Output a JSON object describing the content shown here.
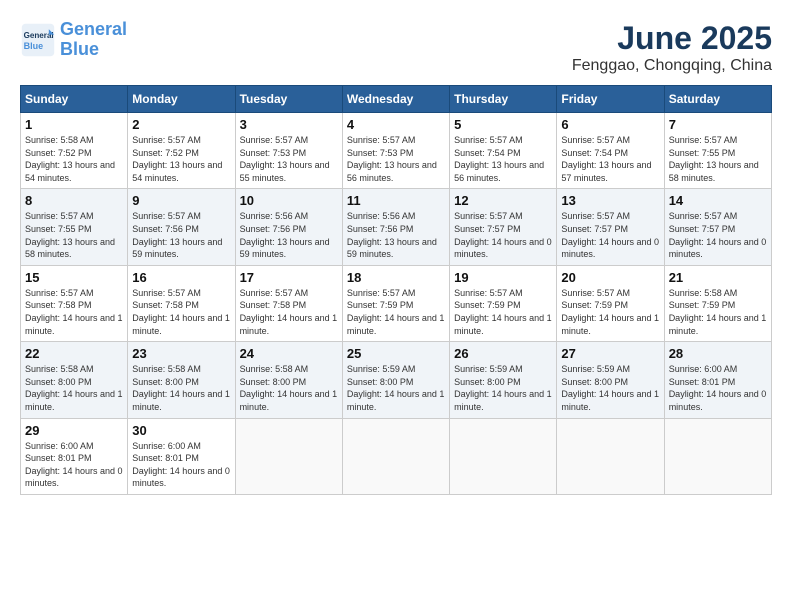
{
  "header": {
    "logo_line1": "General",
    "logo_line2": "Blue",
    "month": "June 2025",
    "location": "Fenggao, Chongqing, China"
  },
  "days_of_week": [
    "Sunday",
    "Monday",
    "Tuesday",
    "Wednesday",
    "Thursday",
    "Friday",
    "Saturday"
  ],
  "weeks": [
    [
      {
        "day": "1",
        "sunrise": "5:58 AM",
        "sunset": "7:52 PM",
        "daylight": "13 hours and 54 minutes."
      },
      {
        "day": "2",
        "sunrise": "5:57 AM",
        "sunset": "7:52 PM",
        "daylight": "13 hours and 54 minutes."
      },
      {
        "day": "3",
        "sunrise": "5:57 AM",
        "sunset": "7:53 PM",
        "daylight": "13 hours and 55 minutes."
      },
      {
        "day": "4",
        "sunrise": "5:57 AM",
        "sunset": "7:53 PM",
        "daylight": "13 hours and 56 minutes."
      },
      {
        "day": "5",
        "sunrise": "5:57 AM",
        "sunset": "7:54 PM",
        "daylight": "13 hours and 56 minutes."
      },
      {
        "day": "6",
        "sunrise": "5:57 AM",
        "sunset": "7:54 PM",
        "daylight": "13 hours and 57 minutes."
      },
      {
        "day": "7",
        "sunrise": "5:57 AM",
        "sunset": "7:55 PM",
        "daylight": "13 hours and 58 minutes."
      }
    ],
    [
      {
        "day": "8",
        "sunrise": "5:57 AM",
        "sunset": "7:55 PM",
        "daylight": "13 hours and 58 minutes."
      },
      {
        "day": "9",
        "sunrise": "5:57 AM",
        "sunset": "7:56 PM",
        "daylight": "13 hours and 59 minutes."
      },
      {
        "day": "10",
        "sunrise": "5:56 AM",
        "sunset": "7:56 PM",
        "daylight": "13 hours and 59 minutes."
      },
      {
        "day": "11",
        "sunrise": "5:56 AM",
        "sunset": "7:56 PM",
        "daylight": "13 hours and 59 minutes."
      },
      {
        "day": "12",
        "sunrise": "5:57 AM",
        "sunset": "7:57 PM",
        "daylight": "14 hours and 0 minutes."
      },
      {
        "day": "13",
        "sunrise": "5:57 AM",
        "sunset": "7:57 PM",
        "daylight": "14 hours and 0 minutes."
      },
      {
        "day": "14",
        "sunrise": "5:57 AM",
        "sunset": "7:57 PM",
        "daylight": "14 hours and 0 minutes."
      }
    ],
    [
      {
        "day": "15",
        "sunrise": "5:57 AM",
        "sunset": "7:58 PM",
        "daylight": "14 hours and 1 minute."
      },
      {
        "day": "16",
        "sunrise": "5:57 AM",
        "sunset": "7:58 PM",
        "daylight": "14 hours and 1 minute."
      },
      {
        "day": "17",
        "sunrise": "5:57 AM",
        "sunset": "7:58 PM",
        "daylight": "14 hours and 1 minute."
      },
      {
        "day": "18",
        "sunrise": "5:57 AM",
        "sunset": "7:59 PM",
        "daylight": "14 hours and 1 minute."
      },
      {
        "day": "19",
        "sunrise": "5:57 AM",
        "sunset": "7:59 PM",
        "daylight": "14 hours and 1 minute."
      },
      {
        "day": "20",
        "sunrise": "5:57 AM",
        "sunset": "7:59 PM",
        "daylight": "14 hours and 1 minute."
      },
      {
        "day": "21",
        "sunrise": "5:58 AM",
        "sunset": "7:59 PM",
        "daylight": "14 hours and 1 minute."
      }
    ],
    [
      {
        "day": "22",
        "sunrise": "5:58 AM",
        "sunset": "8:00 PM",
        "daylight": "14 hours and 1 minute."
      },
      {
        "day": "23",
        "sunrise": "5:58 AM",
        "sunset": "8:00 PM",
        "daylight": "14 hours and 1 minute."
      },
      {
        "day": "24",
        "sunrise": "5:58 AM",
        "sunset": "8:00 PM",
        "daylight": "14 hours and 1 minute."
      },
      {
        "day": "25",
        "sunrise": "5:59 AM",
        "sunset": "8:00 PM",
        "daylight": "14 hours and 1 minute."
      },
      {
        "day": "26",
        "sunrise": "5:59 AM",
        "sunset": "8:00 PM",
        "daylight": "14 hours and 1 minute."
      },
      {
        "day": "27",
        "sunrise": "5:59 AM",
        "sunset": "8:00 PM",
        "daylight": "14 hours and 1 minute."
      },
      {
        "day": "28",
        "sunrise": "6:00 AM",
        "sunset": "8:01 PM",
        "daylight": "14 hours and 0 minutes."
      }
    ],
    [
      {
        "day": "29",
        "sunrise": "6:00 AM",
        "sunset": "8:01 PM",
        "daylight": "14 hours and 0 minutes."
      },
      {
        "day": "30",
        "sunrise": "6:00 AM",
        "sunset": "8:01 PM",
        "daylight": "14 hours and 0 minutes."
      },
      {
        "day": "",
        "sunrise": "",
        "sunset": "",
        "daylight": ""
      },
      {
        "day": "",
        "sunrise": "",
        "sunset": "",
        "daylight": ""
      },
      {
        "day": "",
        "sunrise": "",
        "sunset": "",
        "daylight": ""
      },
      {
        "day": "",
        "sunrise": "",
        "sunset": "",
        "daylight": ""
      },
      {
        "day": "",
        "sunrise": "",
        "sunset": "",
        "daylight": ""
      }
    ]
  ]
}
